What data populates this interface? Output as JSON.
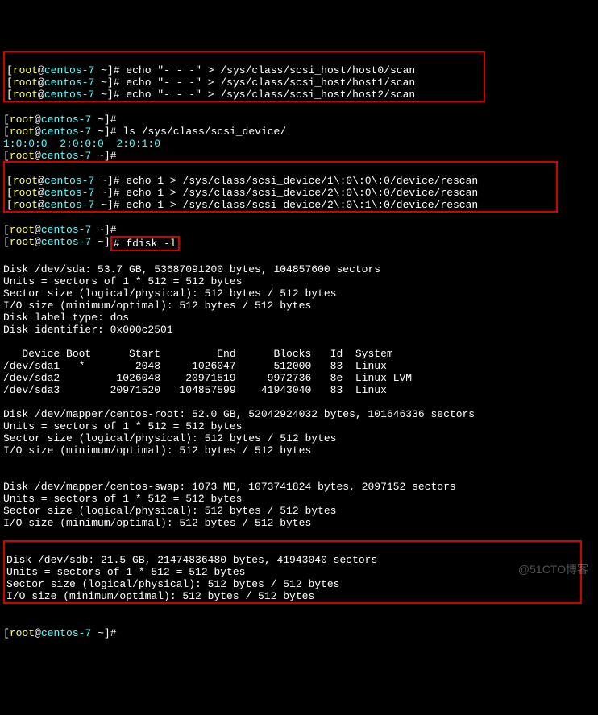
{
  "prompt_user": "root",
  "prompt_host": "centos-7",
  "prompt_path": "~",
  "prompt_symbol": "#",
  "cmds": {
    "scan0": "echo \"- - -\" > /sys/class/scsi_host/host0/scan",
    "scan1": "echo \"- - -\" > /sys/class/scsi_host/host1/scan",
    "scan2": "echo \"- - -\" > /sys/class/scsi_host/host2/scan",
    "ls_scsi": "ls /sys/class/scsi_device/",
    "ls_out": "1:0:0:0  2:0:0:0  2:0:1:0",
    "rescan1": "echo 1 > /sys/class/scsi_device/1\\:0\\:0\\:0/device/rescan",
    "rescan2": "echo 1 > /sys/class/scsi_device/2\\:0\\:0\\:0/device/rescan",
    "rescan3": "echo 1 > /sys/class/scsi_device/2\\:0\\:1\\:0/device/rescan",
    "fdisk": "fdisk -l"
  },
  "fdisk_out": {
    "sda_header": "Disk /dev/sda: 53.7 GB, 53687091200 bytes, 104857600 sectors",
    "units": "Units = sectors of 1 * 512 = 512 bytes",
    "sector": "Sector size (logical/physical): 512 bytes / 512 bytes",
    "io": "I/O size (minimum/optimal): 512 bytes / 512 bytes",
    "label": "Disk label type: dos",
    "ident": "Disk identifier: 0x000c2501",
    "parthdr": "   Device Boot      Start         End      Blocks   Id  System",
    "sda1": "/dev/sda1   *        2048     1026047      512000   83  Linux",
    "sda2": "/dev/sda2         1026048    20971519     9972736   8e  Linux LVM",
    "sda3": "/dev/sda3        20971520   104857599    41943040   83  Linux",
    "root_hdr": "Disk /dev/mapper/centos-root: 52.0 GB, 52042924032 bytes, 101646336 sectors",
    "swap_hdr": "Disk /dev/mapper/centos-swap: 1073 MB, 1073741824 bytes, 2097152 sectors",
    "sdb_hdr": "Disk /dev/sdb: 21.5 GB, 21474836480 bytes, 41943040 sectors"
  },
  "watermark": "@51CTO博客"
}
